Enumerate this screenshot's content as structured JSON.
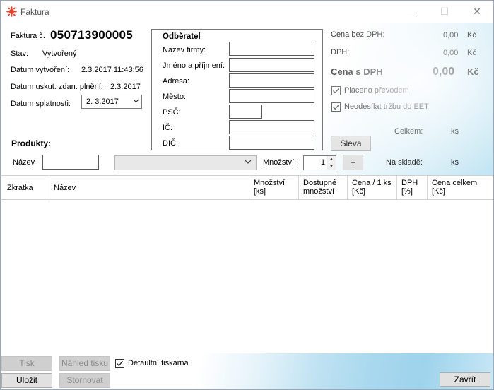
{
  "window": {
    "title": "Faktura",
    "controls": {
      "minimize": "—",
      "maximize": "☐",
      "close": "✕"
    }
  },
  "invoice": {
    "number_label": "Faktura č.",
    "number": "050713900005",
    "status_label": "Stav:",
    "status": "Vytvořený",
    "created_label": "Datum vytvoření:",
    "created": "2.3.2017 11:43:56",
    "taxable_label": "Datum uskut. zdan. plnění:",
    "taxable": "2.3.2017",
    "due_label": "Datum splatnosti:",
    "due": "2.  3.2017"
  },
  "customer": {
    "heading": "Odběratel",
    "fields": [
      {
        "label": "Název firmy:",
        "value": ""
      },
      {
        "label": "Jméno a příjmení:",
        "value": ""
      },
      {
        "label": "Adresa:",
        "value": ""
      },
      {
        "label": "Město:",
        "value": ""
      },
      {
        "label": "PSČ:",
        "value": ""
      },
      {
        "label": "IČ:",
        "value": ""
      },
      {
        "label": "DIČ:",
        "value": ""
      }
    ]
  },
  "totals": {
    "net_label": "Cena bez DPH:",
    "net_value": "0,00",
    "vat_label": "DPH:",
    "vat_value": "0,00",
    "gross_label": "Cena s DPH",
    "gross_value": "0,00",
    "currency": "Kč",
    "paid_transfer_label": "Placeno převodem",
    "paid_transfer_checked": true,
    "no_eet_label": "Neodesílat tržbu do EET",
    "no_eet_checked": true,
    "total_label": "Celkem:",
    "total_unit": "ks",
    "discount_button": "Sleva"
  },
  "products": {
    "heading": "Produkty:",
    "name_label": "Název",
    "name_value": "",
    "product_select": "",
    "quantity_label": "Množství:",
    "quantity_value": "1",
    "add_button": "+",
    "stock_label": "Na skladě:",
    "stock_unit": "ks",
    "columns": [
      {
        "line1": "Zkratka",
        "line2": ""
      },
      {
        "line1": "Název",
        "line2": ""
      },
      {
        "line1": "Množství",
        "line2": "[ks]"
      },
      {
        "line1": "Dostupné",
        "line2": "množství"
      },
      {
        "line1": "Cena / 1 ks",
        "line2": "[Kč]"
      },
      {
        "line1": "DPH",
        "line2": "[%]"
      },
      {
        "line1": "Cena celkem",
        "line2": "[Kč]"
      }
    ],
    "rows": []
  },
  "footer": {
    "print_button": "Tisk",
    "preview_button": "Náhled tisku",
    "default_printer_label": "Defaultní tiskárna",
    "default_printer_checked": true,
    "save_button": "Uložit",
    "cancel_button": "Stornovat",
    "close_button": "Zavřít"
  },
  "colors": {
    "app_icon": "#e8402a",
    "accent_gradient": "#a9d9ee"
  }
}
